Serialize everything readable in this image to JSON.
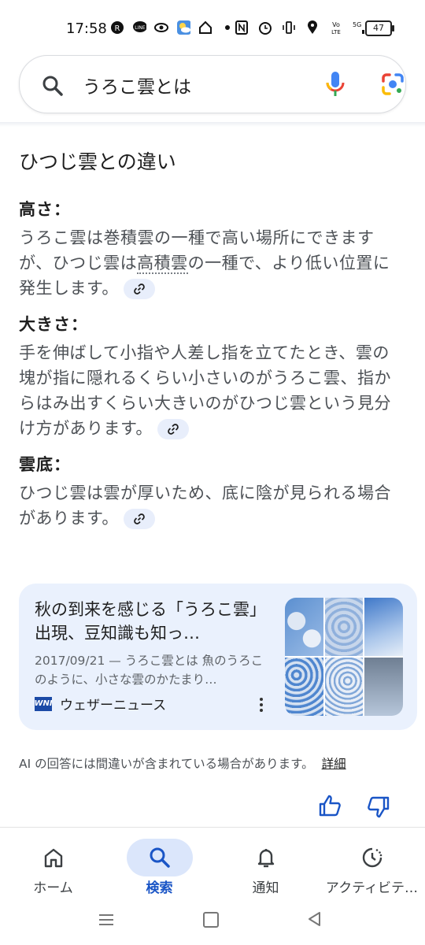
{
  "status": {
    "time": "17:58",
    "battery": "47",
    "network": "5G"
  },
  "search": {
    "query": "うろこ雲とは"
  },
  "answer": {
    "heading": "ひつじ雲との違い",
    "sections": [
      {
        "title": "高さ：",
        "body_pre": "うろこ雲は巻積雲の一種で高い場所にできますが、ひつじ雲は",
        "body_term": "高積雲",
        "body_post": "の一種で、より低い位置に発生します。"
      },
      {
        "title": "大きさ：",
        "body": "手を伸ばして小指や人差し指を立てたとき、雲の塊が指に隠れるくらい小さいのがうろこ雲、指からはみ出すくらい大きいのがひつじ雲という見分け方があります。"
      },
      {
        "title": "雲底：",
        "body": "ひつじ雲は雲が厚いため、底に陰が見られる場合があります。"
      }
    ]
  },
  "card": {
    "title": "秋の到来を感じる「うろこ雲」出現、豆知識も知っ…",
    "snippet": "2017/09/21 — うろこ雲とは 魚のうろこのように、小さな雲のかたまり…",
    "source": "ウェザーニュース",
    "logo_text": "WNI"
  },
  "disclaimer": {
    "text": "AI の回答には間違いが含まれている場合があります。",
    "link": "詳細"
  },
  "nav": {
    "items": [
      {
        "label": "ホーム",
        "icon": "home-icon"
      },
      {
        "label": "検索",
        "icon": "search-icon"
      },
      {
        "label": "通知",
        "icon": "bell-icon"
      },
      {
        "label": "アクティビテ…",
        "icon": "activity-icon"
      }
    ],
    "active": 1
  },
  "colors": {
    "accent": "#1a55c6",
    "card_bg": "#eaf1fd",
    "chip_bg": "#e8eefb"
  }
}
